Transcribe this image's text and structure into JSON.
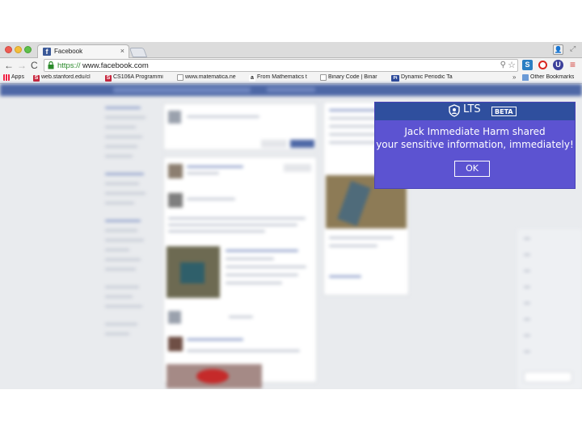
{
  "browser": {
    "tab": {
      "title": "Facebook",
      "close": "×",
      "favicon": "f"
    },
    "nav": {
      "back": "←",
      "forward": "→",
      "reload": "C"
    },
    "omnibox": {
      "scheme": "https://",
      "rest": "www.facebook.com"
    },
    "extensions": {
      "s": "S",
      "opera": "O",
      "lts": "U"
    },
    "menu": "≡",
    "profile": "👤",
    "fullscreen": "⤢"
  },
  "bookmarks": {
    "items": [
      {
        "label": "Apps",
        "icon": "apps-icon"
      },
      {
        "label": "web.stanford.edu/cl",
        "icon": "stanford-s-icon",
        "glyph": "S"
      },
      {
        "label": "CS106A Programmi",
        "icon": "stanford-s-icon",
        "glyph": "S"
      },
      {
        "label": "www.matematica.ne",
        "icon": "page-icon"
      },
      {
        "label": "From Mathematics t",
        "icon": "amazon-icon",
        "glyph": "a"
      },
      {
        "label": "Binary Code | Binar",
        "icon": "page-icon"
      },
      {
        "label": "Dynamic Periodic Ta",
        "icon": "ptable-icon",
        "glyph": "Pt"
      }
    ],
    "more": "»",
    "other": "Other Bookmarks"
  },
  "lts": {
    "title": "LTS",
    "badge": "BETA",
    "message_line1": "Jack Immediate Harm shared",
    "message_line2": "your sensitive information, immediately!",
    "ok_label": "OK"
  },
  "colors": {
    "popup_bg": "#5c53d1",
    "popup_header": "#2f4f9e",
    "fb_blue": "#4e68a6"
  }
}
